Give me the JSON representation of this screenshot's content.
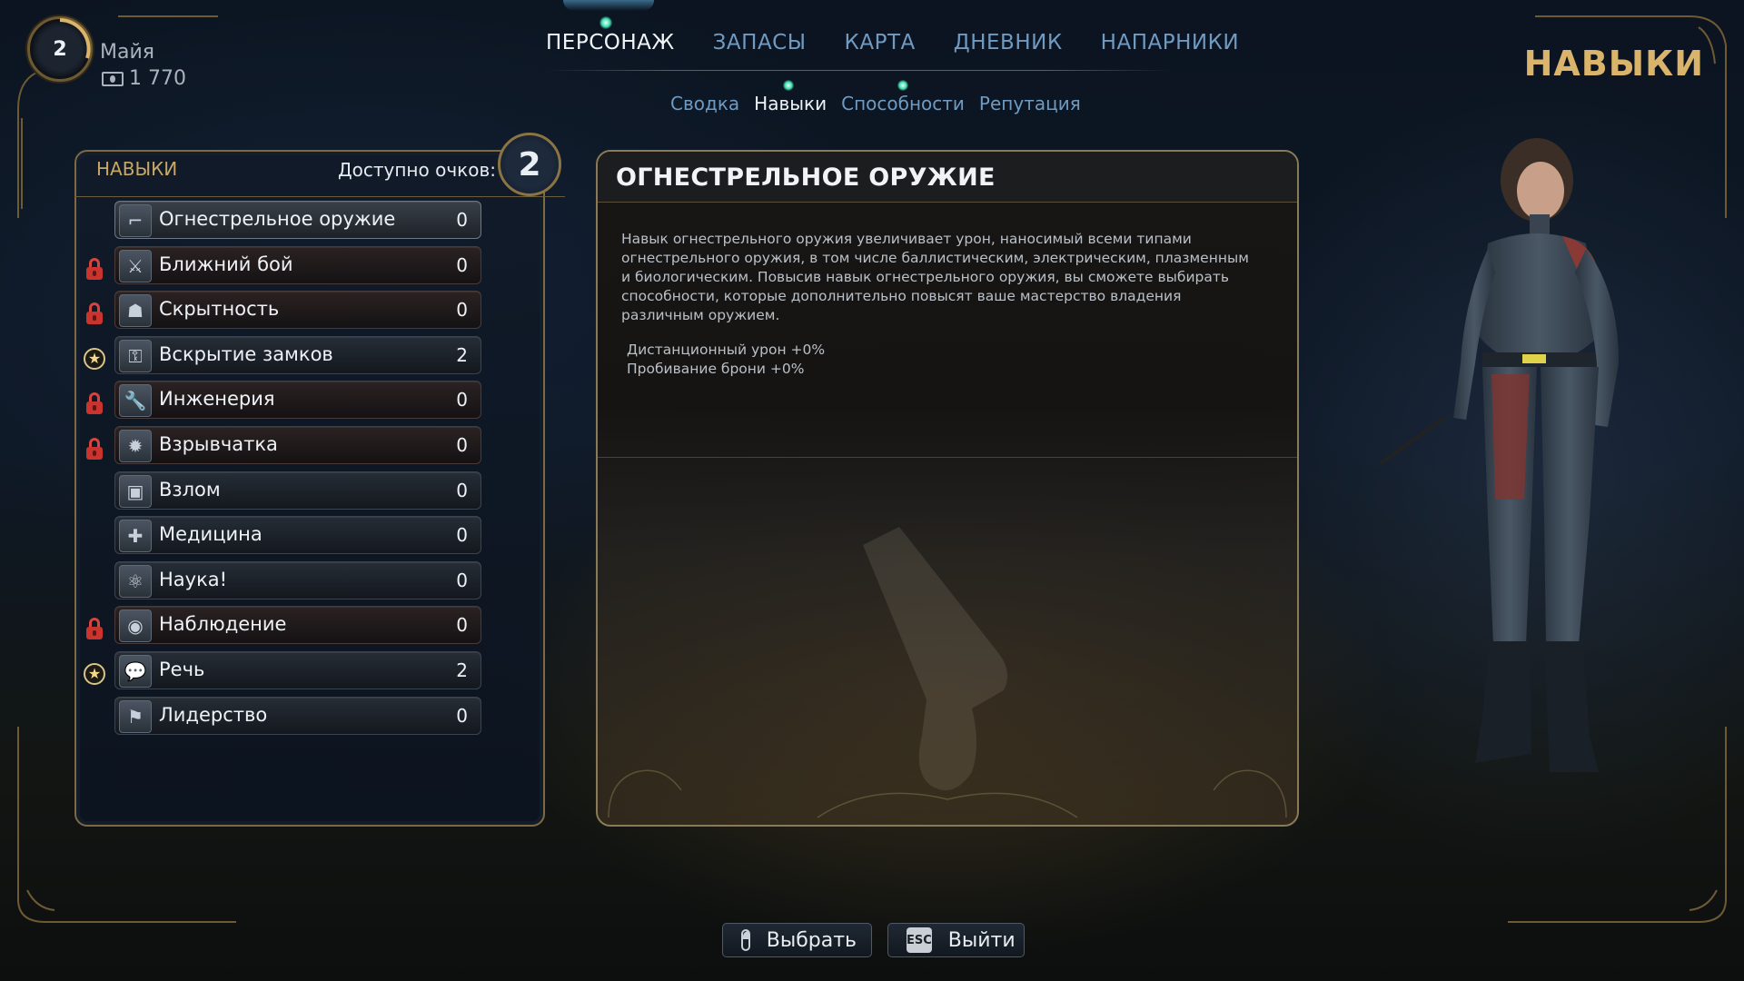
{
  "player": {
    "level": "2",
    "name": "Майя",
    "currency": "1 770"
  },
  "nav": {
    "main_tabs": [
      "ПЕРСОНАЖ",
      "ЗАПАСЫ",
      "КАРТА",
      "ДНЕВНИК",
      "НАПАРНИКИ"
    ],
    "active_main_tab": "ПЕРСОНАЖ",
    "sub_tabs": [
      "Сводка",
      "Навыки",
      "Способности",
      "Репутация"
    ],
    "active_sub_tab": "Навыки"
  },
  "page_heading": "НАВЫКИ",
  "skills_panel": {
    "title": "НАВЫКИ",
    "points_label": "Доступно очков:",
    "points_value": "2",
    "skills": [
      {
        "name": "Огнестрельное оружие",
        "value": "0",
        "marker": "none",
        "icon": "pistol-icon",
        "selected": true
      },
      {
        "name": "Ближний бой",
        "value": "0",
        "marker": "lock",
        "icon": "melee-icon"
      },
      {
        "name": "Скрытность",
        "value": "0",
        "marker": "lock",
        "icon": "stealth-icon"
      },
      {
        "name": "Вскрытие замков",
        "value": "2",
        "marker": "star",
        "icon": "lockpick-icon"
      },
      {
        "name": "Инженерия",
        "value": "0",
        "marker": "lock",
        "icon": "wrench-icon"
      },
      {
        "name": "Взрывчатка",
        "value": "0",
        "marker": "lock",
        "icon": "explosive-icon"
      },
      {
        "name": "Взлом",
        "value": "0",
        "marker": "none",
        "icon": "hack-icon"
      },
      {
        "name": "Медицина",
        "value": "0",
        "marker": "none",
        "icon": "medkit-icon"
      },
      {
        "name": "Наука!",
        "value": "0",
        "marker": "none",
        "icon": "atom-icon"
      },
      {
        "name": "Наблюдение",
        "value": "0",
        "marker": "lock",
        "icon": "eye-icon"
      },
      {
        "name": "Речь",
        "value": "2",
        "marker": "star",
        "icon": "speech-icon"
      },
      {
        "name": "Лидерство",
        "value": "0",
        "marker": "none",
        "icon": "flag-icon"
      }
    ]
  },
  "detail": {
    "title": "ОГНЕСТРЕЛЬНОЕ ОРУЖИЕ",
    "description": "Навык огнестрельного оружия увеличивает урон, наносимый всеми типами огнестрельного оружия, в том числе баллистическим, электрическим, плазменным и биологическим. Повысив навык огнестрельного оружия, вы сможете выбирать способности, которые дополнительно повысят ваше мастерство владения различным оружием.",
    "stats": [
      "Дистанционный урон +0%",
      "Пробивание брони +0%"
    ]
  },
  "prompts": {
    "select_label": "Выбрать",
    "exit_key": "ESC",
    "exit_label": "Выйти"
  },
  "colors": {
    "accent_gold": "#d9b46a",
    "tab_blue": "#6f9bc2",
    "lock_red": "#c9342e",
    "gem_green": "#3fe0b0"
  }
}
